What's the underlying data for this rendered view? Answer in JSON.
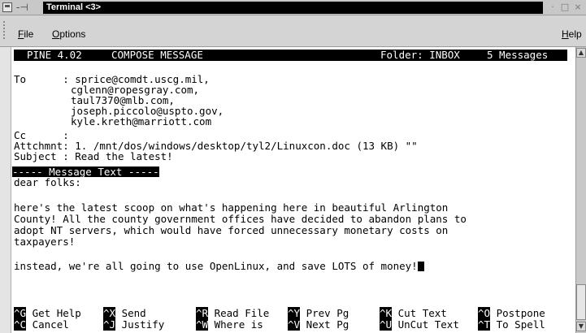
{
  "window": {
    "title": "Terminal <3>",
    "icon": "terminal-window-icon",
    "pin_glyph": "-⊣",
    "minimize_glyph": "·",
    "maximize_glyph": "□",
    "close_glyph": "×"
  },
  "menubar": {
    "file": "File",
    "options": "Options",
    "help": "Help"
  },
  "pine": {
    "header": {
      "version": "PINE 4.02",
      "mode": "COMPOSE MESSAGE",
      "folder": "Folder: INBOX",
      "count": "5 Messages"
    },
    "fields": {
      "to_label": "To      : ",
      "to_lines": [
        "sprice@comdt.uscg.mil,",
        "cglenn@ropesgray.com,",
        "taul7370@mlb.com,",
        "joseph.piccolo@uspto.gov,",
        "kyle.kreth@marriott.com"
      ],
      "cc_label": "Cc      :",
      "attachment_label": "Attchmnt: ",
      "attachment_value": "1. /mnt/dos/windows/desktop/tyl2/Linuxcon.doc (13 KB) \"\"",
      "subject_label": "Subject : ",
      "subject_value": "Read the latest!"
    },
    "separator": "----- Message Text -----",
    "body": [
      "dear folks:",
      "",
      "here's the latest scoop on what's happening here in beautiful Arlington",
      "County! All the county government offices have decided to abandon plans to",
      "adopt NT servers, which would have forced unnecessary monetary costs on",
      "taxpayers!",
      "",
      "instead, we're all going to use OpenLinux, and save LOTS of money!"
    ],
    "keys_row1": [
      {
        "key": "^G",
        "label": " Get Help"
      },
      {
        "key": "^X",
        "label": " Send"
      },
      {
        "key": "^R",
        "label": " Read File"
      },
      {
        "key": "^Y",
        "label": " Prev Pg"
      },
      {
        "key": "^K",
        "label": " Cut Text"
      },
      {
        "key": "^O",
        "label": " Postpone"
      }
    ],
    "keys_row2": [
      {
        "key": "^C",
        "label": " Cancel"
      },
      {
        "key": "^J",
        "label": " Justify"
      },
      {
        "key": "^W",
        "label": " Where is"
      },
      {
        "key": "^V",
        "label": " Next Pg"
      },
      {
        "key": "^U",
        "label": " UnCut Text"
      },
      {
        "key": "^T",
        "label": " To Spell"
      }
    ]
  },
  "scrollbar": {
    "up_glyph": "▲",
    "down_glyph": "▼"
  }
}
